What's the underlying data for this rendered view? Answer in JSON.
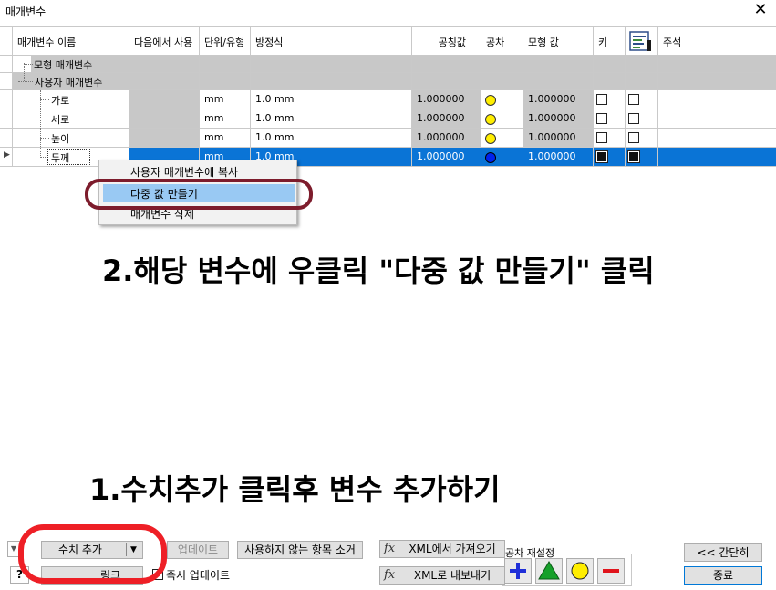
{
  "window": {
    "title": "매개변수",
    "close_glyph": "✕"
  },
  "columns": [
    {
      "key": "name",
      "label": "매개변수 이름"
    },
    {
      "key": "source",
      "label": "다음에서 사용"
    },
    {
      "key": "unit",
      "label": "단위/유형"
    },
    {
      "key": "equation",
      "label": "방정식"
    },
    {
      "key": "nominal",
      "label": "공칭값"
    },
    {
      "key": "tolerance",
      "label": "공차"
    },
    {
      "key": "model_value",
      "label": "모형 값"
    },
    {
      "key": "key",
      "label": "키"
    },
    {
      "key": "export",
      "label": ""
    },
    {
      "key": "comment",
      "label": "주석"
    }
  ],
  "groups": {
    "model": "모형 매개변수",
    "user": "사용자 매개변수"
  },
  "rows": [
    {
      "name": "가로",
      "unit": "mm",
      "equation": "1.0 mm",
      "nominal": "1.000000",
      "model_value": "1.000000",
      "selected": false
    },
    {
      "name": "세로",
      "unit": "mm",
      "equation": "1.0 mm",
      "nominal": "1.000000",
      "model_value": "1.000000",
      "selected": false
    },
    {
      "name": "높이",
      "unit": "mm",
      "equation": "1.0 mm",
      "nominal": "1.000000",
      "model_value": "1.000000",
      "selected": false
    },
    {
      "name": "두께",
      "unit": "mm",
      "equation": "1.0 mm",
      "nominal": "1.000000",
      "model_value": "1.000000",
      "selected": true
    }
  ],
  "context_menu": {
    "items": [
      "사용자 매개변수에 복사",
      "다중 값 만들기",
      "매개변수 삭제"
    ],
    "highlighted_index": 1
  },
  "annotations": {
    "step2": "2.해당 변수에 우클릭 \"다중 값 만들기\" 클릭",
    "step1": "1.수치추가 클릭후 변수 추가하기"
  },
  "toolbar": {
    "add_number": "수치 추가",
    "dropdown_glyph": "▼",
    "update": "업데이트",
    "purge_unused": "사용하지 않는 항목 소거",
    "import_xml": "XML에서 가져오기",
    "export_xml": "XML로 내보내기",
    "tolerance_reset": "공차 재설정",
    "fx_glyph": "fx",
    "filter_glyph": "▼",
    "help_glyph": "?",
    "link": "링크",
    "immediate_update": "즉시 업데이트",
    "less": "<< 간단히",
    "done": "종료"
  },
  "colors": {
    "selection": "#0a74d6",
    "menu_highlight": "#99c9f3",
    "annotation_oval_dark": "#7d1c2c",
    "annotation_oval_red": "#ee1f26",
    "tolerance_plus": "#1f2fd8",
    "tolerance_triangle": "#16a02a",
    "tolerance_circle": "#ffee00",
    "tolerance_minus": "#e0141c"
  }
}
